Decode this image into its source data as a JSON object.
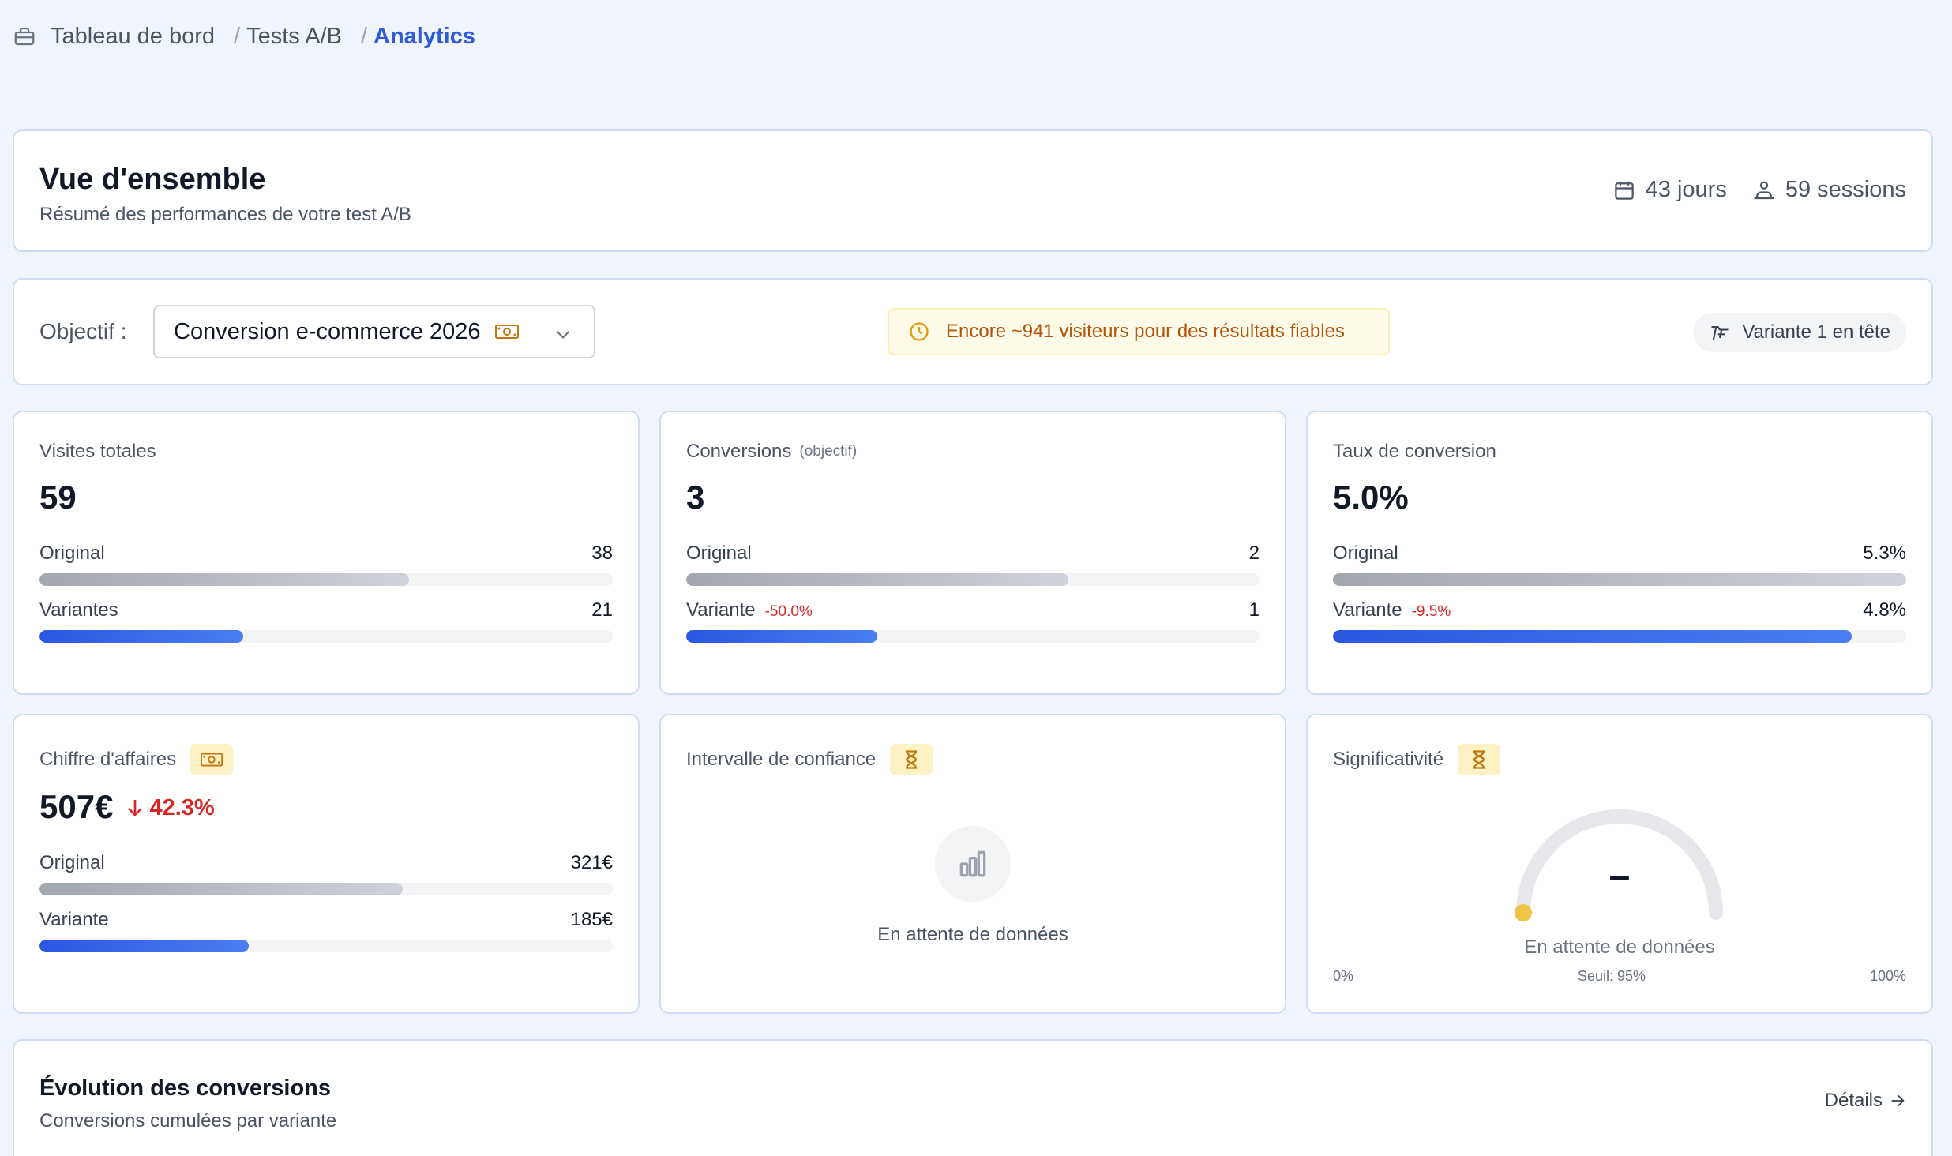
{
  "breadcrumb": {
    "items": [
      "Tableau de bord",
      "Tests A/B",
      "Analytics"
    ]
  },
  "header": {
    "title": "Vue d'ensemble",
    "subtitle": "Résumé des performances de votre test A/B",
    "days": "43 jours",
    "sessions": "59 sessions"
  },
  "objective": {
    "label": "Objectif :",
    "selected": "Conversion e-commerce 2026",
    "notice": "Encore ~941 visiteurs pour des résultats fiables",
    "leader": "Variante 1 en tête"
  },
  "metrics": {
    "visits": {
      "label": "Visites totales",
      "value": "59",
      "rows": [
        {
          "label": "Original",
          "value": "38",
          "fraction": 0.644
        },
        {
          "label": "Variantes",
          "value": "21",
          "fraction": 0.356
        }
      ]
    },
    "conversions": {
      "label": "Conversions",
      "tag": "(objectif)",
      "value": "3",
      "rows": [
        {
          "label": "Original",
          "value": "2",
          "fraction": 0.667
        },
        {
          "label": "Variante",
          "delta": "-50.0%",
          "value": "1",
          "fraction": 0.333
        }
      ]
    },
    "rate": {
      "label": "Taux de conversion",
      "value": "5.0%",
      "rows": [
        {
          "label": "Original",
          "value": "5.3%",
          "fraction": 1.0
        },
        {
          "label": "Variante",
          "delta": "-9.5%",
          "value": "4.8%",
          "fraction": 0.905
        }
      ]
    },
    "revenue": {
      "label": "Chiffre d'affaires",
      "value": "507€",
      "delta": "42.3%",
      "rows": [
        {
          "label": "Original",
          "value": "321€",
          "fraction": 0.633
        },
        {
          "label": "Variante",
          "value": "185€",
          "fraction": 0.365
        }
      ]
    },
    "confidence": {
      "label": "Intervalle de confiance",
      "empty": "En attente de données"
    },
    "significance": {
      "label": "Significativité",
      "value": "–",
      "empty": "En attente de données",
      "scale_min": "0%",
      "scale_mid": "Seuil: 95%",
      "scale_max": "100%"
    }
  },
  "evolution": {
    "title": "Évolution des conversions",
    "subtitle": "Conversions cumulées par variante",
    "link": "Détails"
  },
  "colors": {
    "accent": "#2f5bd8",
    "negative": "#dc2626",
    "warning_bg": "#fefbe8",
    "warning_text": "#b45309",
    "badge_bg": "#fdf2c4",
    "gauge_dot": "#f0c544"
  },
  "icons": {
    "breadcrumb": "briefcase-icon",
    "days": "calendar-icon",
    "sessions": "users-icon",
    "objective": "money-icon",
    "notice": "clock-icon",
    "leader": "trophy-icon",
    "pending": "hourglass-icon",
    "empty": "bar-chart-icon",
    "link": "arrow-right-icon"
  }
}
